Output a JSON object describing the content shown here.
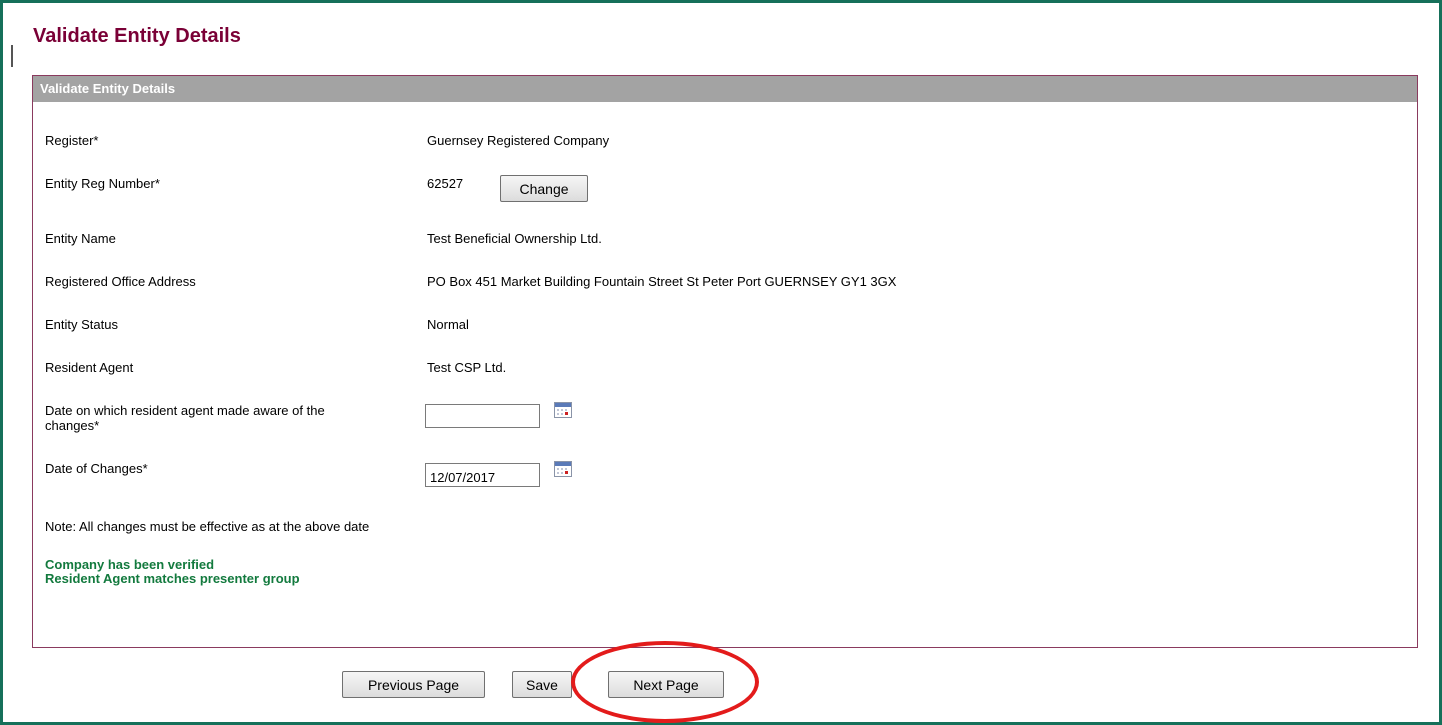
{
  "page": {
    "title": "Validate Entity Details"
  },
  "panel": {
    "header": "Validate Entity Details"
  },
  "fields": {
    "register": {
      "label": "Register*",
      "value": "Guernsey Registered Company"
    },
    "entity_reg_number": {
      "label": "Entity Reg Number*",
      "value": "62527",
      "change_button": "Change"
    },
    "entity_name": {
      "label": "Entity Name",
      "value": "Test Beneficial Ownership Ltd."
    },
    "registered_office_address": {
      "label": "Registered Office Address",
      "value": "PO Box 451 Market Building Fountain Street St Peter Port GUERNSEY GY1 3GX"
    },
    "entity_status": {
      "label": "Entity Status",
      "value": "Normal"
    },
    "resident_agent": {
      "label": "Resident Agent",
      "value": "Test CSP Ltd."
    },
    "date_agent_aware": {
      "label_line1": "Date on which resident agent made aware of the",
      "label_line2": "changes*",
      "value": ""
    },
    "date_of_changes": {
      "label": "Date of Changes*",
      "value": "12/07/2017"
    }
  },
  "note": "Note: All changes must be effective as at the above date",
  "status_messages": [
    "Company has been verified",
    "Resident Agent matches presenter group"
  ],
  "buttons": {
    "previous": "Previous Page",
    "save": "Save",
    "next": "Next Page"
  },
  "annotation": {
    "color": "#e31b1b"
  }
}
